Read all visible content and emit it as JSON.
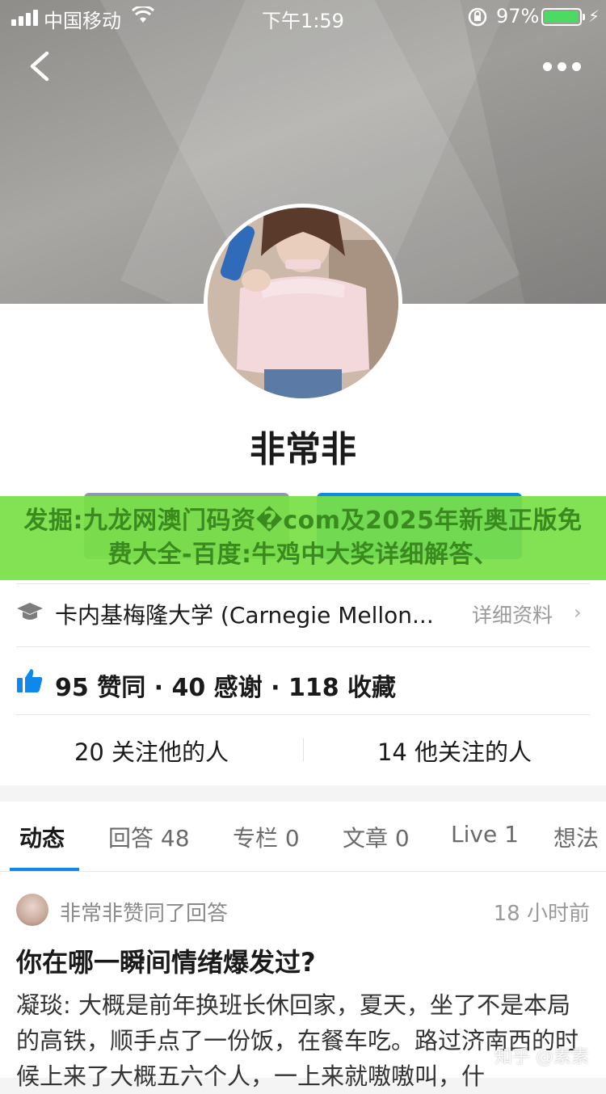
{
  "status_bar": {
    "carrier": "中国移动",
    "time": "下午1:59",
    "battery_percent": "97%",
    "battery_level": 0.97,
    "icons": [
      "signal-icon",
      "wifi-icon",
      "orientation-lock-icon",
      "battery-icon",
      "charging-bolt-icon"
    ]
  },
  "nav": {
    "back_icon": "chevron-left-icon",
    "more_icon": "more-dots-icon"
  },
  "profile": {
    "name": "非常非",
    "education": "卡内基梅隆大学 (Carnegie Mellon...",
    "detail_link": "详细资料",
    "stats": "95 赞同 · 40 感谢 · 118 收藏",
    "followers": "20 关注他的人",
    "following": "14 他关注的人"
  },
  "overlay_banner": {
    "text": "发掘:九龙网澳门码资�com及2025年新奥正版免费大全-百度:牛鸡中大奖详细解答、"
  },
  "tabs": [
    {
      "label": "动态",
      "active": true
    },
    {
      "label": "回答 48",
      "active": false
    },
    {
      "label": "专栏 0",
      "active": false
    },
    {
      "label": "文章 0",
      "active": false
    },
    {
      "label": "Live 1",
      "active": false
    },
    {
      "label": "想法",
      "active": false
    }
  ],
  "feed_item": {
    "action": "非常非赞同了回答",
    "time": "18 小时前",
    "title": "你在哪一瞬间情绪爆发过?",
    "excerpt": "凝琰: 大概是前年换班长休回家，夏天，坐了不是本局的高铁，顺手点了一份饭，在餐车吃。路过济南西的时候上来了大概五六个人，一上来就嗷嗷叫，什"
  },
  "watermark": "知乎 @素素",
  "colors": {
    "accent": "#0f88eb",
    "banner": "#78e046",
    "banner_text": "#3a8a20"
  }
}
